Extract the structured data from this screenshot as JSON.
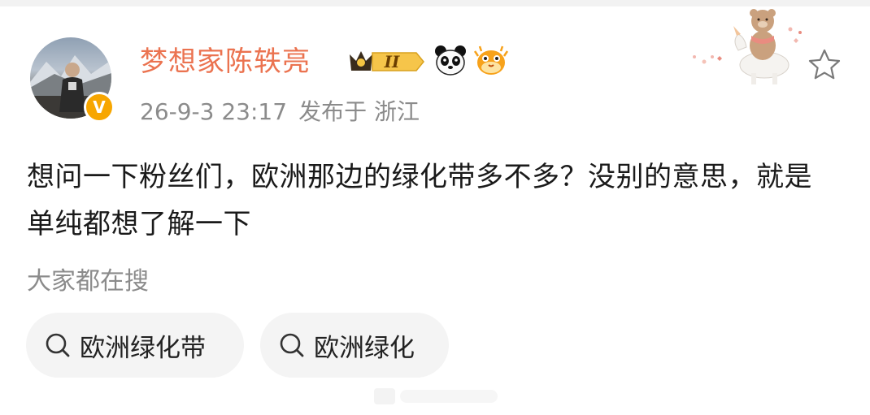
{
  "post": {
    "author": {
      "name": "梦想家陈轶亮",
      "verified_badge_symbol": "V",
      "vip_badge_text": "II",
      "badge_icons": [
        "crown-vip-badge-icon",
        "panda-icon",
        "pufferfish-icon"
      ]
    },
    "meta": {
      "datetime": "26-9-3 23:17",
      "location": "发布于 浙江"
    },
    "text": "想问一下粉丝们，欧洲那边的绿化带多不多？没别的意思，就是单纯都想了解一下"
  },
  "search": {
    "title": "大家都在搜",
    "chips": [
      {
        "label": "欧洲绿化带",
        "icon": "search-icon"
      },
      {
        "label": "欧洲绿化",
        "icon": "search-icon"
      }
    ]
  },
  "colors": {
    "username": "#eb7350",
    "secondary_text": "#8b8b8b",
    "verify_badge": "#f7a600",
    "chip_bg": "#f4f4f4"
  }
}
